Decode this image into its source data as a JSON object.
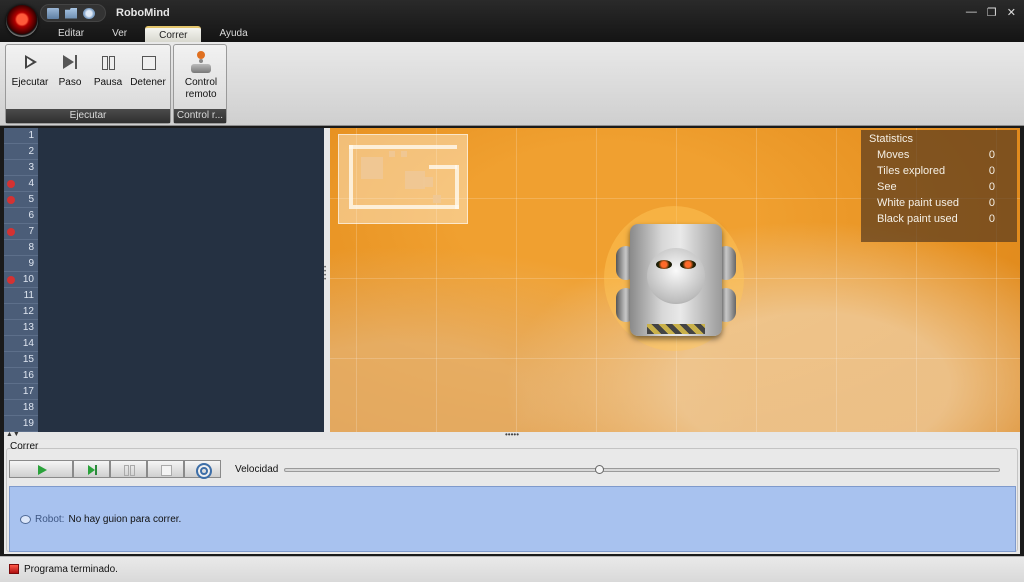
{
  "app": {
    "title": "RoboMind"
  },
  "window_controls": {
    "minimize": "—",
    "restore": "❐",
    "close": "✕"
  },
  "menu_tabs": [
    {
      "label": "Editar",
      "active": false
    },
    {
      "label": "Ver",
      "active": false
    },
    {
      "label": "Correr",
      "active": true
    },
    {
      "label": "Ayuda",
      "active": false
    }
  ],
  "ribbon": {
    "groups": {
      "run": {
        "label": "Ejecutar",
        "buttons": [
          {
            "label": "Ejecutar",
            "icon": "play-icon"
          },
          {
            "label": "Paso",
            "icon": "step-icon"
          },
          {
            "label": "Pausa",
            "icon": "pause-icon"
          },
          {
            "label": "Detener",
            "icon": "stop-icon"
          }
        ]
      },
      "remote": {
        "label": "Control r...",
        "buttons": [
          {
            "label": "Control remoto",
            "icon": "joystick-icon"
          }
        ]
      }
    }
  },
  "editor": {
    "line_numbers": [
      "1",
      "2",
      "3",
      "4",
      "5",
      "6",
      "7",
      "8",
      "9",
      "10",
      "11",
      "12",
      "13",
      "14",
      "15",
      "16",
      "17",
      "18",
      "19"
    ],
    "breakpoints": [
      4,
      5,
      7,
      10
    ],
    "breakpoint_color": "#d43232"
  },
  "statistics": {
    "title": "Statistics",
    "rows": [
      {
        "label": "Moves",
        "value": "0"
      },
      {
        "label": "Tiles explored",
        "value": "0"
      },
      {
        "label": "See",
        "value": "0"
      },
      {
        "label": "White paint used",
        "value": "0"
      },
      {
        "label": "Black paint used",
        "value": "0"
      }
    ]
  },
  "run_panel": {
    "title": "Correr",
    "speed_label": "Velocidad",
    "speed_value": 0.44,
    "message": {
      "sender": "Robot:",
      "text": "No hay guion para correr."
    }
  },
  "status": {
    "text": "Programa terminado."
  },
  "colors": {
    "accent": "#e3c46b",
    "world": "#e69020",
    "message_bg": "#a8c2ef",
    "editor_bg": "#253142"
  }
}
